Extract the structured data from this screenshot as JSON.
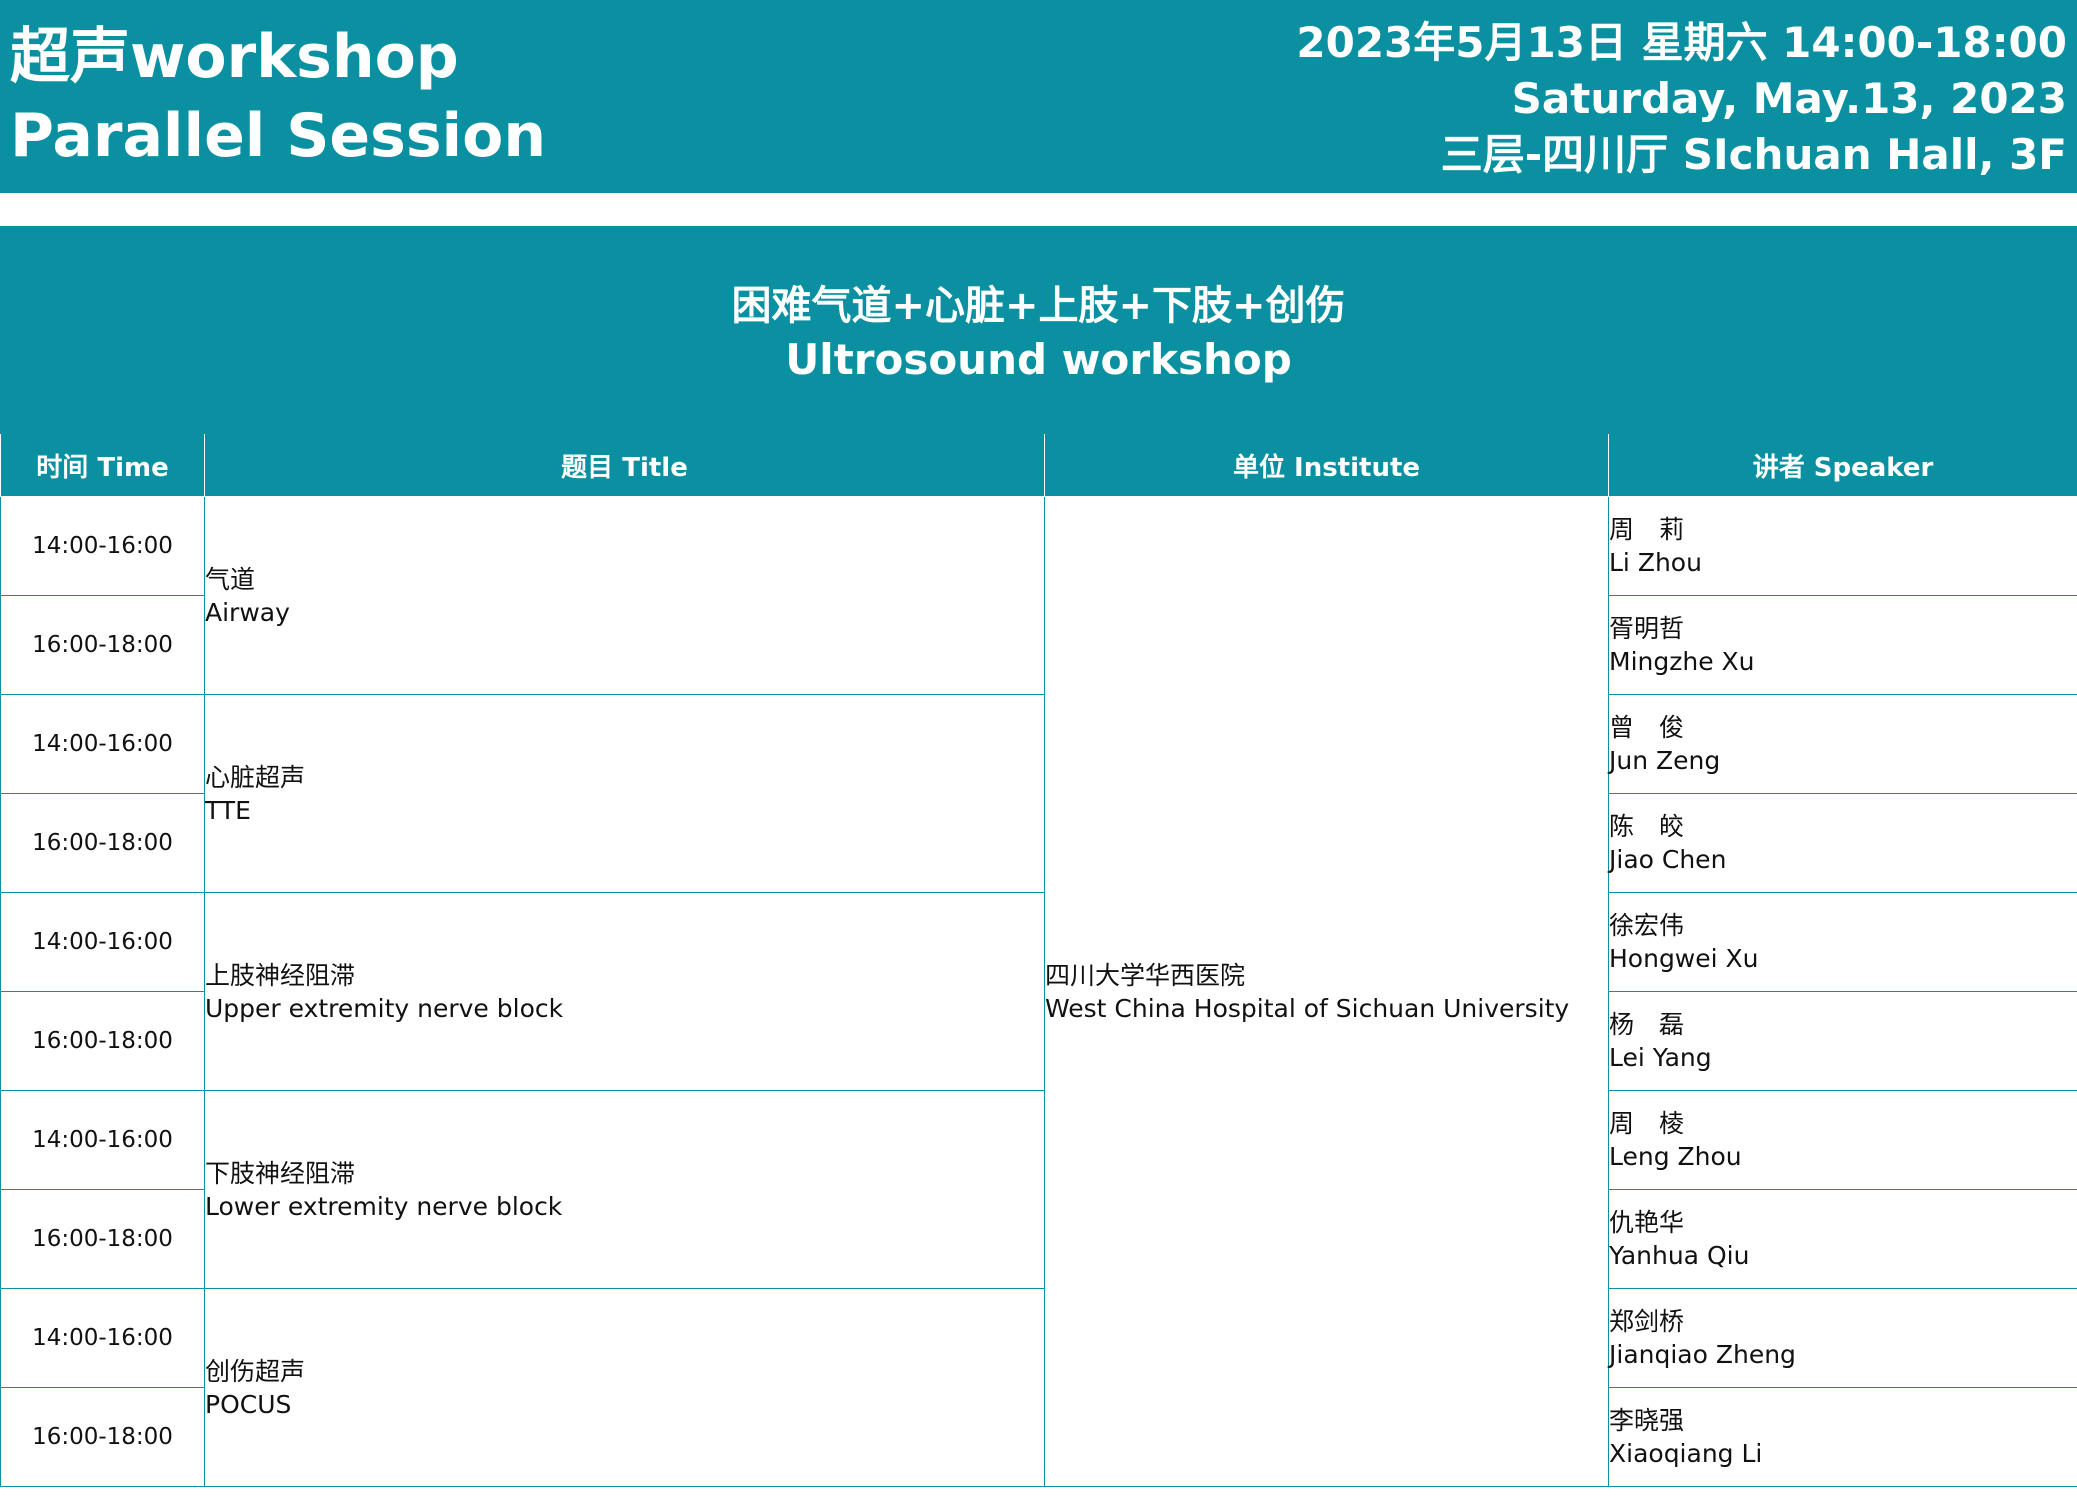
{
  "header": {
    "title_line1": "超声workshop",
    "title_line2": "Parallel Session",
    "date_zh": "2023年5月13日 星期六 14:00-18:00",
    "date_en": "Saturday, May.13, 2023",
    "venue": "三层-四川厅 SIchuan Hall, 3F"
  },
  "session": {
    "title_zh": "困难气道+心脏+上肢+下肢+创伤",
    "title_en": "Ultrosound workshop"
  },
  "table": {
    "columns": [
      "时间 Time",
      "题目 Title",
      "单位 Institute",
      "讲者 Speaker"
    ],
    "institute": {
      "zh": "四川大学华西医院",
      "en": "West China Hospital of Sichuan University"
    },
    "topics": [
      {
        "zh": "气道",
        "en": "Airway"
      },
      {
        "zh": "心脏超声",
        "en": "TTE"
      },
      {
        "zh": "上肢神经阻滞",
        "en": "Upper extremity nerve block"
      },
      {
        "zh": "下肢神经阻滞",
        "en": "Lower extremity nerve block"
      },
      {
        "zh": "创伤超声",
        "en": "POCUS"
      }
    ],
    "rows": [
      {
        "time": "14:00-16:00",
        "speaker_zh": "周　莉",
        "speaker_en": "Li Zhou"
      },
      {
        "time": "16:00-18:00",
        "speaker_zh": "胥明哲",
        "speaker_en": "Mingzhe Xu"
      },
      {
        "time": "14:00-16:00",
        "speaker_zh": "曾　俊",
        "speaker_en": "Jun Zeng"
      },
      {
        "time": "16:00-18:00",
        "speaker_zh": "陈　皎",
        "speaker_en": "Jiao Chen"
      },
      {
        "time": "14:00-16:00",
        "speaker_zh": "徐宏伟",
        "speaker_en": "Hongwei Xu"
      },
      {
        "time": "16:00-18:00",
        "speaker_zh": "杨　磊",
        "speaker_en": "Lei Yang"
      },
      {
        "time": "14:00-16:00",
        "speaker_zh": "周　棱",
        "speaker_en": "Leng Zhou"
      },
      {
        "time": "16:00-18:00",
        "speaker_zh": "仇艳华",
        "speaker_en": "Yanhua Qiu"
      },
      {
        "time": "14:00-16:00",
        "speaker_zh": "郑剑桥",
        "speaker_en": "Jianqiao Zheng"
      },
      {
        "time": "16:00-18:00",
        "speaker_zh": "李晓强",
        "speaker_en": "Xiaoqiang Li"
      }
    ]
  },
  "colors": {
    "accent": "#0a90a0",
    "background": "#ffffff",
    "text": "#111111"
  }
}
